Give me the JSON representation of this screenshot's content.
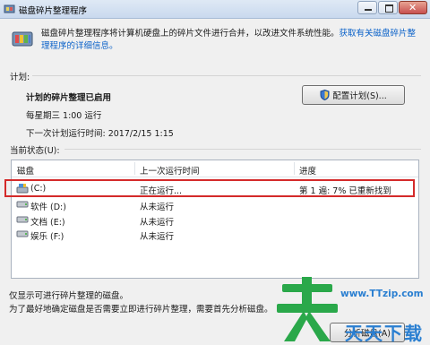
{
  "window": {
    "title": "磁盘碎片整理程序"
  },
  "intro": {
    "text": "磁盘碎片整理程序将计算机硬盘上的碎片文件进行合并，以改进文件系统性能。",
    "link": "获取有关磁盘碎片整理程序的详细信息。"
  },
  "schedule": {
    "label": "计划:",
    "status": "计划的碎片整理已启用",
    "recurrence": "每星期三  1:00 运行",
    "next_run": "下一次计划运行时间: 2017/2/15 1:15",
    "configure_button": "配置计划(S)..."
  },
  "current_status": {
    "label": "当前状态(U):",
    "columns": [
      "磁盘",
      "上一次运行时间",
      "进度"
    ],
    "rows": [
      {
        "disk": "(C:)",
        "last_run": "正在运行...",
        "progress": "第 1 遍: 7% 已重新找到"
      },
      {
        "disk": "软件 (D:)",
        "last_run": "从未运行",
        "progress": ""
      },
      {
        "disk": "文档 (E:)",
        "last_run": "从未运行",
        "progress": ""
      },
      {
        "disk": "娱乐 (F:)",
        "last_run": "从未运行",
        "progress": ""
      }
    ]
  },
  "footer": {
    "line1": "仅显示可进行碎片整理的磁盘。",
    "line2": "为了最好地确定磁盘是否需要立即进行碎片整理，需要首先分析磁盘。",
    "analyze_button": "分析磁盘(A)"
  },
  "watermark": {
    "url": "www.TTzip.com",
    "text": "天天下载"
  },
  "colors": {
    "highlight": "#d42a2a",
    "link": "#0b62c9",
    "watermark": "#2a7fd1"
  },
  "icons": [
    "defrag-app-icon",
    "shield-icon",
    "drive-icon"
  ]
}
